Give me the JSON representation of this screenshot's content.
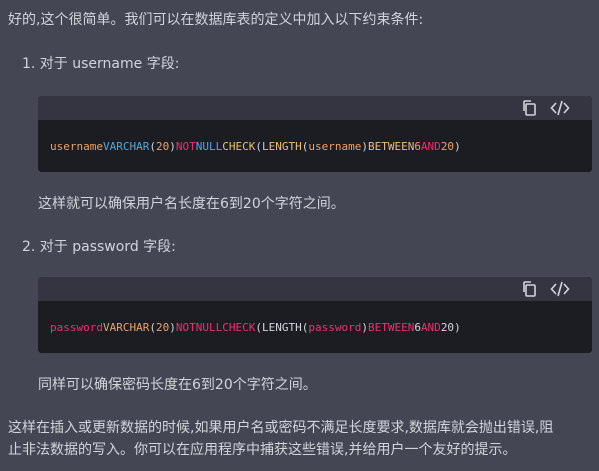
{
  "intro": "好的,这个很简单。我们可以在数据库表的定义中加入以下约束条件:",
  "items": [
    {
      "label": "1. 对于 username 字段:",
      "code": {
        "t1": "username",
        "t2": "VARCHAR",
        "t3": "(",
        "t4": "20",
        "t5": ")",
        "t6": "NOT",
        "t7": "NULL",
        "t8": "CHECK",
        "t9": "(",
        "t10": "LENGTH",
        "t11": "(",
        "t12": "username",
        "t13": ")",
        "t14": "BETWEEN",
        "t15": "6",
        "t16": "AND",
        "t17": "20",
        "t18": ")"
      },
      "note": "这样就可以确保用户名长度在6到20个字符之间。"
    },
    {
      "label": "2. 对于 password 字段:",
      "code": {
        "t1": "password",
        "t2": "VARCHAR",
        "t3": "(",
        "t4": "20",
        "t5": ")",
        "t6": "NOT",
        "t7": "NULL",
        "t8": "CHECK",
        "t9": "(",
        "t10": "LENGTH",
        "t11": "(",
        "t12": "password",
        "t13": ")",
        "t14": "BETWEEN",
        "t15": "6",
        "t16": "AND",
        "t17": "20",
        "t18": ")"
      },
      "note": "同样可以确保密码长度在6到20个字符之间。"
    }
  ],
  "outro_line1": "这样在插入或更新数据的时候,如果用户名或密码不满足长度要求,数据库就会抛出错误,阻",
  "outro_line2": "止非法数据的写入。你可以在应用程序中捕获这些错误,并给用户一个友好的提示。",
  "icons": {
    "copy": "copy-icon",
    "code": "code-icon"
  }
}
